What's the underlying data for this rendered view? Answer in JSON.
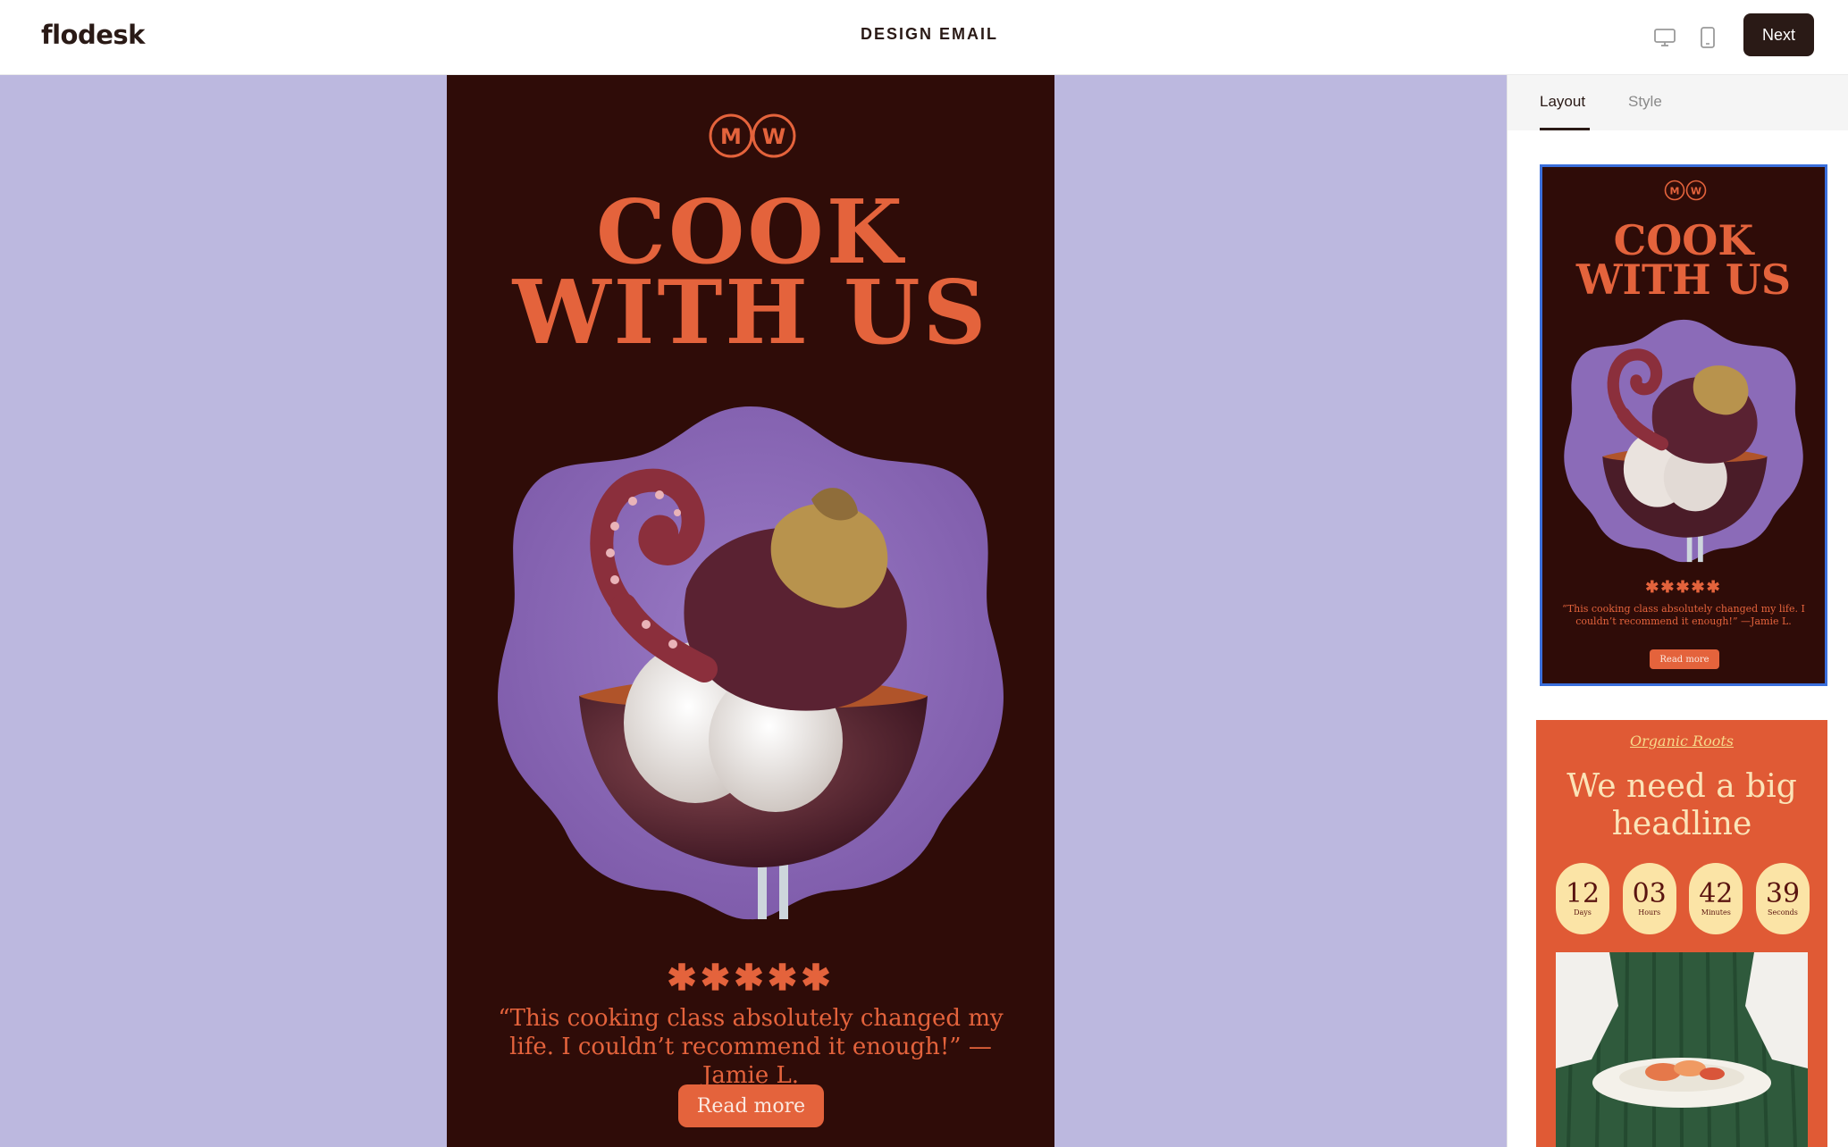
{
  "app": {
    "logo": "flodesk",
    "title": "DESIGN EMAIL",
    "devices": [
      "desktop-icon",
      "mobile-icon"
    ],
    "next_label": "Next"
  },
  "canvas": {
    "background": "#bcb8df",
    "email": {
      "background": "#2f0c08",
      "accent": "#e4633c",
      "logo_letters": [
        "M",
        "W"
      ],
      "headline_line1": "COOK",
      "headline_line2": "WITH US",
      "rating_stars": "✱✱✱✱✱",
      "quote": "“This cooking class absolutely changed my life. I couldn’t recommend it enough!” —Jamie L.",
      "button_label": "Read more"
    }
  },
  "panel": {
    "tabs": [
      {
        "label": "Layout",
        "active": true
      },
      {
        "label": "Style",
        "active": false
      }
    ],
    "templates": [
      {
        "selected": true,
        "logo_letters": [
          "M",
          "W"
        ],
        "headline_line1": "COOK",
        "headline_line2": "WITH US",
        "rating_stars": "✱✱✱✱✱",
        "quote": "“This cooking class absolutely changed my life. I couldn’t recommend it enough!” —Jamie L.",
        "button_label": "Read more"
      },
      {
        "selected": false,
        "brand": "Organic Roots",
        "headline": "We need a big headline",
        "countdown": [
          {
            "value": "12",
            "label": "Days"
          },
          {
            "value": "03",
            "label": "Hours"
          },
          {
            "value": "42",
            "label": "Minutes"
          },
          {
            "value": "39",
            "label": "Seconds"
          }
        ],
        "background": "#e05a35"
      }
    ],
    "selected_border_color": "#3a6fdc"
  }
}
